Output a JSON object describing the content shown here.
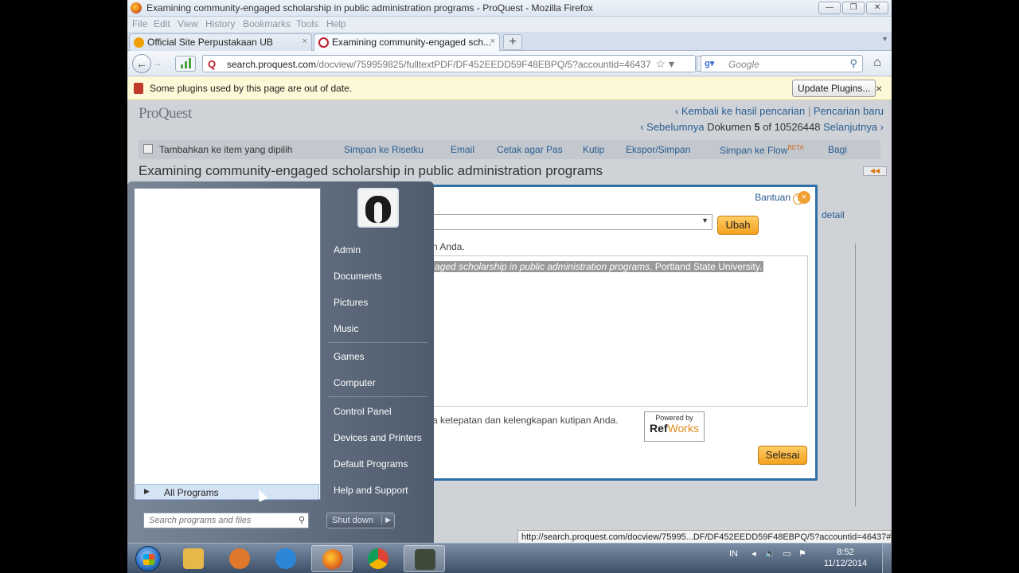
{
  "window": {
    "title": "Examining community-engaged scholarship in public administration programs - ProQuest - Mozilla Firefox",
    "controls": {
      "minimize": "—",
      "maximize": "❐",
      "close": "✕"
    }
  },
  "menubar": [
    "File",
    "Edit",
    "View",
    "History",
    "Bookmarks",
    "Tools",
    "Help"
  ],
  "tabs": [
    {
      "label": "Official Site Perpustakaan UB",
      "icon": "ub-icon",
      "close": "×"
    },
    {
      "label": "Examining community-engaged sch...",
      "icon": "proquest-icon",
      "close": "×"
    }
  ],
  "newtab": "+",
  "navbar": {
    "url_domain": "search.proquest.com",
    "url_path": "/docview/759959825/fulltextPDF/DF452EEDD59F48EBPQ/5?accountid=46437",
    "search_placeholder": "Google"
  },
  "pluginbar": {
    "message": "Some plugins used by this page are out of date.",
    "button": "Update Plugins...",
    "close": "×"
  },
  "proquest": {
    "logo": "ProQuest",
    "back_link": "‹ Kembali ke hasil pencarian",
    "separator": "|",
    "new_search": "Pencarian baru",
    "prev": "‹ Sebelumnya",
    "doc_label": "Dokumen",
    "doc_index": "5",
    "doc_of": "of 10526448",
    "next": "Selanjutnya ›",
    "toolbar": {
      "add_item": "Tambahkan ke item yang dipilih",
      "save": "Simpan ke Risetku",
      "email": "Email",
      "print": "Cetak agar Pas",
      "cite": "Kutip",
      "export": "Ekspor/Simpan",
      "flow": "Simpan ke Flow",
      "beta": "BETA",
      "share": "Bagi"
    },
    "doc_title": "Examining community-engaged scholarship in public administration programs",
    "detail": "detail"
  },
  "dialog": {
    "help": "Bantuan",
    "change_button": "Ubah",
    "hint_top": "n Anda.",
    "citation_italic": "aged scholarship in public administration programs",
    "citation_rest": ", Portland State University.",
    "hint_bottom": "a ketepatan dan kelengkapan kutipan Anda.",
    "powered_by": "Powered by",
    "refworks_ref": "Ref",
    "refworks_works": "Works",
    "done_button": "Selesai"
  },
  "statusbar": {
    "url": "http://search.proquest.com/docview/75995...DF/DF452EEDD59F48EBPQ/5?accountid=46437#"
  },
  "startmenu": {
    "all_programs": "All Programs",
    "search_placeholder": "Search programs and files",
    "right_items": [
      "Admin",
      "Documents",
      "Pictures",
      "Music",
      "Games",
      "Computer",
      "Control Panel",
      "Devices and Printers",
      "Default Programs",
      "Help and Support"
    ],
    "shutdown": "Shut down"
  },
  "taskbar": {
    "items": [
      {
        "name": "explorer",
        "color": "#e6b84a"
      },
      {
        "name": "media-player",
        "color": "#e0782b"
      },
      {
        "name": "internet-explorer",
        "color": "#2b86d8"
      },
      {
        "name": "firefox",
        "color": "#e2661b"
      },
      {
        "name": "chrome",
        "color": "#3aa757"
      },
      {
        "name": "camtasia",
        "color": "#4a4a4a"
      }
    ],
    "language": "IN",
    "time": "8:52",
    "date": "11/12/2014"
  },
  "colors": {
    "proquest_link": "#2a5c8f",
    "orange_button": "#f3a21e",
    "dialog_border": "#2f6fa7"
  }
}
